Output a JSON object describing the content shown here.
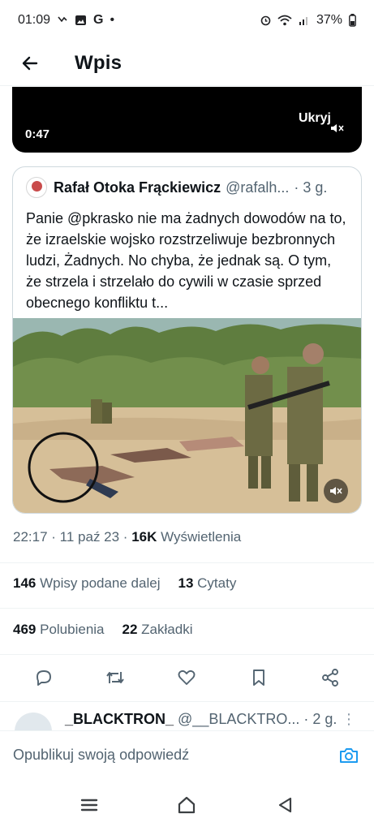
{
  "status_bar": {
    "time": "01:09",
    "google_letter": "G",
    "dot": "•",
    "battery": "37%"
  },
  "header": {
    "title": "Wpis"
  },
  "video": {
    "duration": "0:47",
    "hide_label": "Ukryj"
  },
  "quoted_tweet": {
    "name": "Rafał Otoka Frąckiewicz",
    "handle": "@rafalh...",
    "time": "· 3 g.",
    "text": "Panie @pkrasko nie ma żadnych dowodów na to, że izraelskie wojsko rozstrzeliwuje bezbronnych ludzi, Żadnych. No chyba, że jednak są. O tym, że strzela i strzelało do cywili w czasie sprzed obecnego konfliktu t..."
  },
  "meta": {
    "time": "22:17",
    "date": "· 11 paź 23 ·",
    "views_count": "16K",
    "views_label": "Wyświetlenia"
  },
  "stats": {
    "reposts_count": "146",
    "reposts_label": "Wpisy podane dalej",
    "quotes_count": "13",
    "quotes_label": "Cytaty",
    "likes_count": "469",
    "likes_label": "Polubienia",
    "bookmarks_count": "22",
    "bookmarks_label": "Zakładki"
  },
  "reply_preview": {
    "name": "_BLACKTRON_",
    "handle": "@__BLACKTRO...",
    "time": "· 2 g."
  },
  "composer": {
    "placeholder": "Opublikuj swoją odpowiedź"
  },
  "icons": {
    "back": "arrow-left-icon",
    "reply": "comment-icon",
    "repost": "retweet-icon",
    "like": "heart-icon",
    "bookmark": "bookmark-icon",
    "share": "share-icon",
    "camera": "camera-icon",
    "mute": "mute-icon"
  },
  "colors": {
    "accent": "#1d9bf0",
    "text": "#0f1419",
    "secondary": "#536471"
  }
}
